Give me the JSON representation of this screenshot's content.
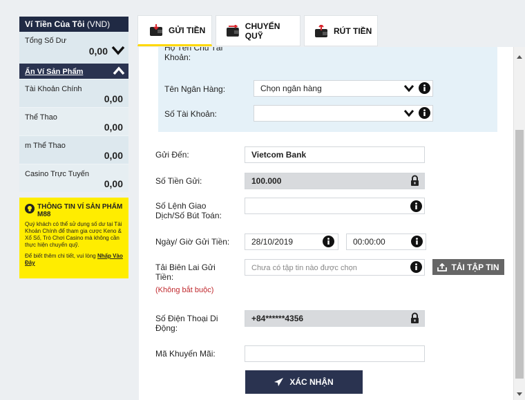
{
  "wallet": {
    "title": "Ví Tiền Của Tôi",
    "currency": "(VND)",
    "total_label": "Tổng Số Dư",
    "total_value": "0,00",
    "toggle_label": "Ẩn Ví Sản Phẩm",
    "items": [
      {
        "label": "Tài Khoản Chính",
        "value": "0,00"
      },
      {
        "label": "Thể Thao",
        "value": "0,00"
      },
      {
        "label": "m Thể Thao",
        "value": "0,00"
      },
      {
        "label": "Casino Trực Tuyến",
        "value": "0,00"
      }
    ]
  },
  "info": {
    "title": "THÔNG TIN VÍ SẢN PHẨM M88",
    "body": "Quý khách có thể sử dụng số dư tại Tài Khoản Chính để tham gia cược Keno & Xổ Số, Trò Chơi Casino mà không cần thực hiện chuyển quỹ.",
    "more_prefix": "Để biết thêm chi tiết, vui lòng ",
    "more_link": "Nhấp Vào Đây"
  },
  "tabs": [
    {
      "label": "GỬI TIỀN"
    },
    {
      "label": "CHUYỂN QUỸ"
    },
    {
      "label": "RÚT TIỀN"
    }
  ],
  "form": {
    "account_holder_label": "Họ Tên Chủ Tài Khoản:",
    "bank_name_label": "Tên Ngân Hàng:",
    "bank_name_value": "Chọn ngân hàng",
    "account_number_label": "Số Tài Khoản:",
    "account_number_value": "",
    "send_to_label": "Gửi Đến:",
    "send_to_value": "Vietcom Bank",
    "amount_label": "Số Tiền Gửi:",
    "amount_value": "100.000",
    "ref_label": "Số Lệnh Giao Dịch/Số Bút Toán:",
    "ref_value": "",
    "datetime_label": "Ngày/ Giờ Gửi Tiền:",
    "date_value": "28/10/2019",
    "time_value": "00:00:00",
    "receipt_label": "Tải Biên Lai Gửi Tiền:",
    "receipt_placeholder": "Chưa có tập tin nào được chọn",
    "upload_label": "TẢI TẬP TIN",
    "optional_label": "(Không bắt buộc)",
    "phone_label": "Số Điện Thoại Di Động:",
    "phone_value": "+84******4356",
    "promo_label": "Mã Khuyến Mãi:",
    "promo_value": "",
    "submit_label": "XÁC NHẬN"
  },
  "colors": {
    "navy": "#202a44",
    "yellow": "#ffed00",
    "tab_accent": "#ffd800",
    "wallet_bg": "#dde8ee",
    "bank_block_bg": "#e5f1f8",
    "optional_red": "#c0282d"
  }
}
